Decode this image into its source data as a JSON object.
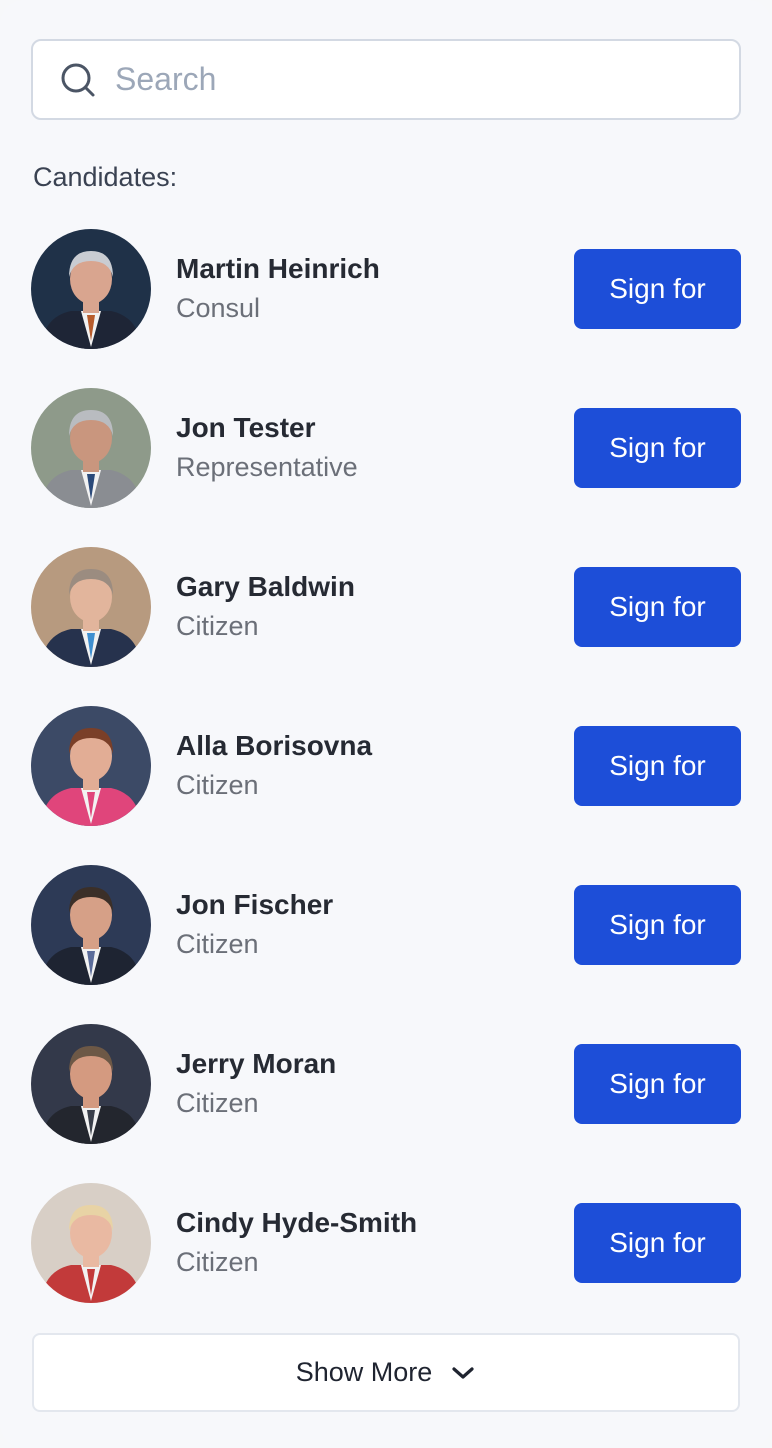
{
  "search": {
    "placeholder": "Search",
    "value": ""
  },
  "section_label": "Candidates:",
  "candidates": [
    {
      "name": "Martin Heinrich",
      "title": "Consul",
      "action": "Sign for",
      "bg": "#1f3148",
      "hair": "#c9ccd2",
      "skin": "#d9a58f",
      "suit": "#1e2536",
      "tie": "#b85c2c"
    },
    {
      "name": "Jon Tester",
      "title": "Representative",
      "action": "Sign for",
      "bg": "#8e9a8a",
      "hair": "#b9bcc0",
      "skin": "#c9967e",
      "suit": "#8a8d92",
      "tie": "#2b4a7a"
    },
    {
      "name": "Gary Baldwin",
      "title": "Citizen",
      "action": "Sign for",
      "bg": "#b79a7f",
      "hair": "#9b8c80",
      "skin": "#e2b59c",
      "suit": "#26324d",
      "tie": "#3f8fd0"
    },
    {
      "name": "Alla Borisovna",
      "title": "Citizen",
      "action": "Sign for",
      "bg": "#3c4a66",
      "hair": "#7a3f28",
      "skin": "#e2ad95",
      "suit": "#e0457b",
      "tie": "#e0457b"
    },
    {
      "name": "Jon Fischer",
      "title": "Citizen",
      "action": "Sign for",
      "bg": "#2d3a56",
      "hair": "#3b2f28",
      "skin": "#d6a087",
      "suit": "#1e2432",
      "tie": "#5b6c9a"
    },
    {
      "name": "Jerry Moran",
      "title": "Citizen",
      "action": "Sign for",
      "bg": "#33394a",
      "hair": "#6d5846",
      "skin": "#d49a80",
      "suit": "#23262e",
      "tie": "#3a3f4a"
    },
    {
      "name": "Cindy Hyde-Smith",
      "title": "Citizen",
      "action": "Sign for",
      "bg": "#d8cfc6",
      "hair": "#e8d3a5",
      "skin": "#e9b9a2",
      "suit": "#c23a3a",
      "tie": "#c23a3a"
    }
  ],
  "show_more_label": "Show More"
}
